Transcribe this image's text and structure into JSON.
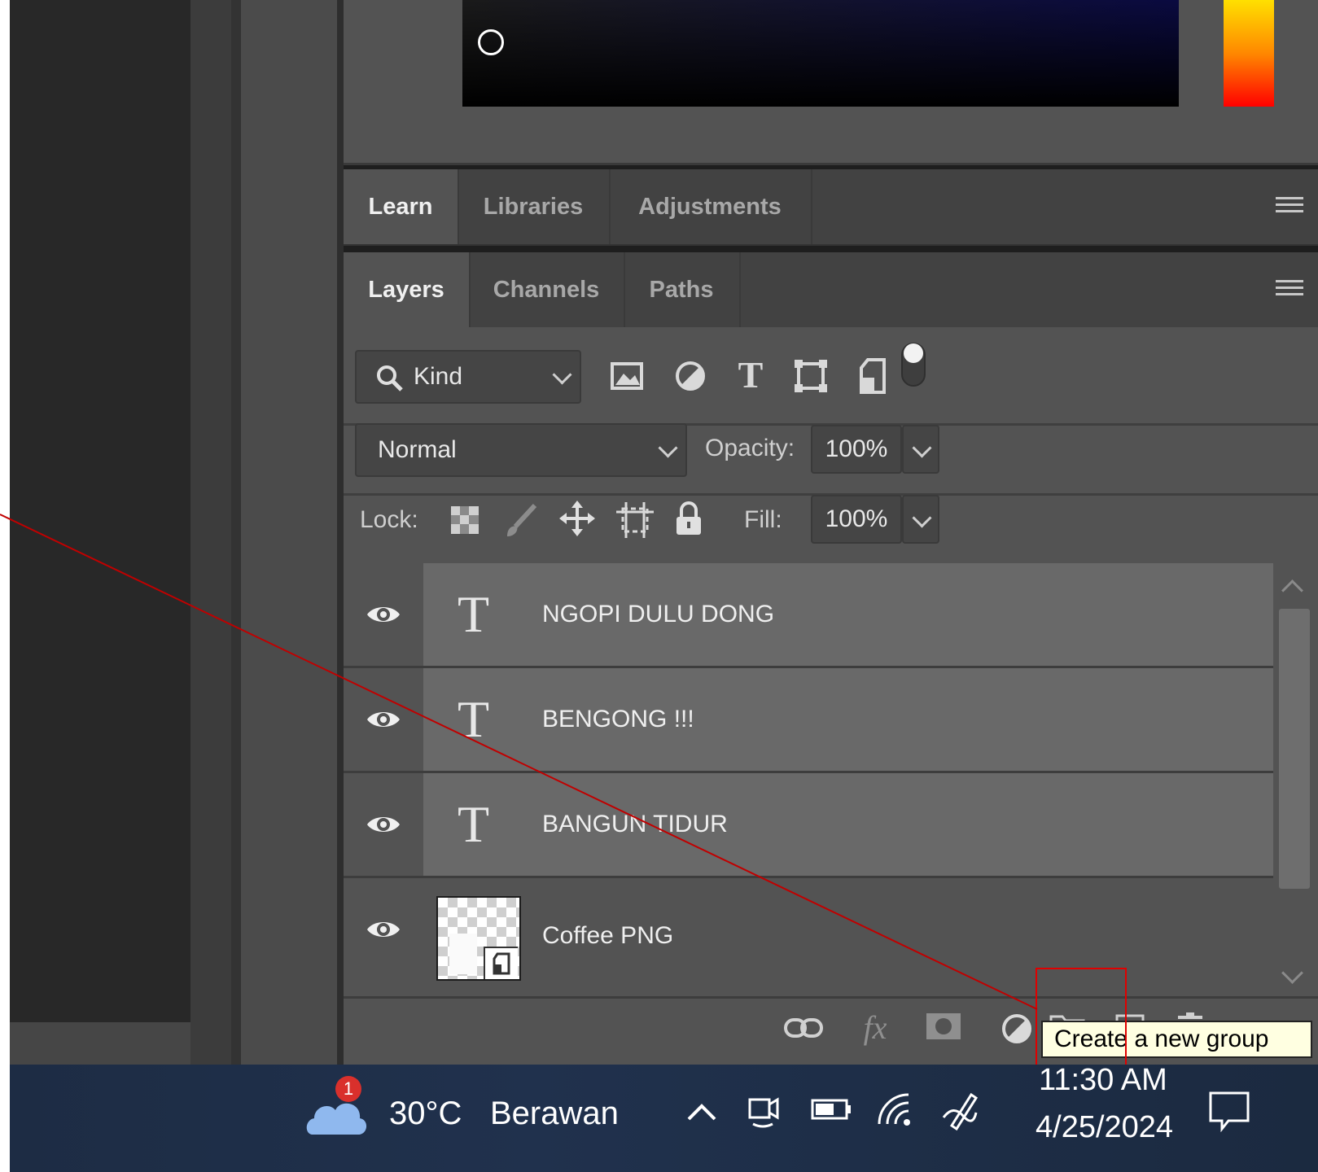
{
  "top_tabs": {
    "items": [
      "Learn",
      "Libraries",
      "Adjustments"
    ],
    "active": "Learn"
  },
  "layers_tabs": {
    "items": [
      "Layers",
      "Channels",
      "Paths"
    ],
    "active": "Layers"
  },
  "filter": {
    "kind_label": "Kind"
  },
  "blend": {
    "mode": "Normal",
    "opacity_label": "Opacity:",
    "opacity_value": "100%"
  },
  "lock": {
    "label": "Lock:",
    "fill_label": "Fill:",
    "fill_value": "100%"
  },
  "layers": [
    {
      "name": "NGOPI DULU DONG",
      "type": "text",
      "visible": true
    },
    {
      "name": "BENGONG !!!",
      "type": "text",
      "visible": true
    },
    {
      "name": "BANGUN TIDUR",
      "type": "text",
      "visible": true
    },
    {
      "name": "Coffee PNG",
      "type": "smart-object",
      "visible": true
    }
  ],
  "tooltip": "Create a new group",
  "taskbar": {
    "weather_badge": "1",
    "temperature": "30°C",
    "condition": "Berawan",
    "time": "11:30 AM",
    "date": "4/25/2024"
  },
  "colors": {
    "panel": "#535353",
    "selected_row": "#696969",
    "tooltip_bg": "#ffffe1",
    "highlight": "#e00000"
  }
}
